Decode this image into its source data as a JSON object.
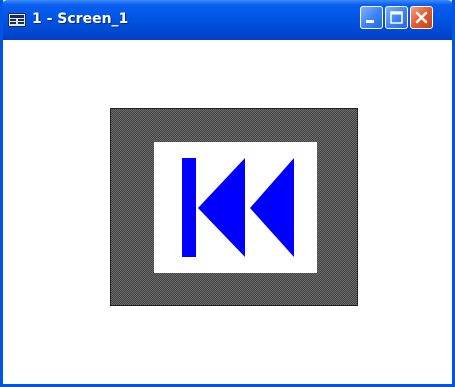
{
  "window": {
    "title": "1 - Screen_1",
    "controls": {
      "minimize": "minimize-icon",
      "maximize": "maximize-icon",
      "close": "close-icon"
    }
  },
  "content": {
    "button": {
      "icon": "skip-to-start-icon",
      "icon_color": "#0000ff",
      "frame_color": "#555555"
    }
  },
  "colors": {
    "titlebar": "#0055e5",
    "close": "#e35a2d"
  }
}
